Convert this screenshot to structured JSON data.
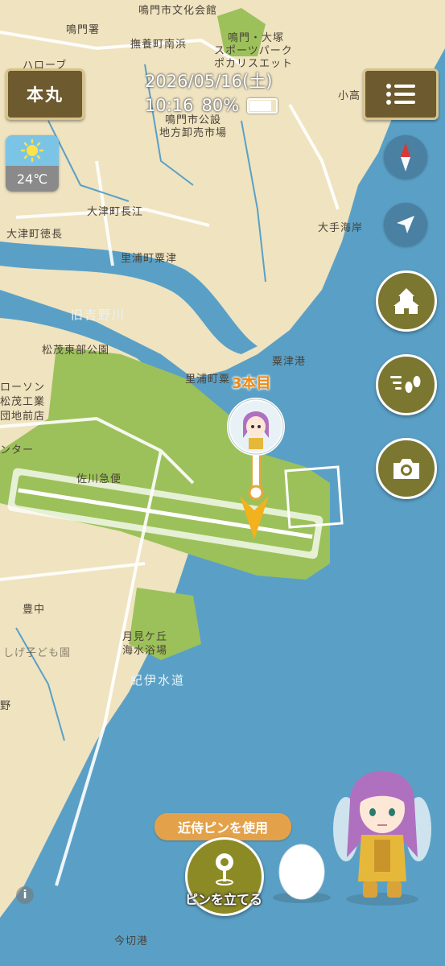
{
  "header": {
    "castle_button": "本丸",
    "date": "2026/05/16(土)",
    "time": "10:16",
    "battery": "80%",
    "battery_level": 0.8
  },
  "weather": {
    "icon": "sun-icon",
    "temperature": "24℃"
  },
  "map_labels": {
    "l1": "鳴門市文化会館",
    "l2": "鳴門署",
    "l3": "撫養町南浜",
    "l4": "鳴門・大塚",
    "l5": "スポーツパーク",
    "l6": "ポカリスエット",
    "l7": "鳴門市公設",
    "l8": "地方卸売市場",
    "l9": "小高",
    "l10": "大津町長江",
    "l11": "大津町徳長",
    "l12": "大手海岸",
    "l13": "里浦町粟津",
    "l14": "旧吉野川",
    "l15": "松茂東部公園",
    "l16": "粟津港",
    "l17": "里浦町粟",
    "l18": "ローソン",
    "l19": "松茂工業",
    "l20": "団地前店",
    "l21": "ンター",
    "l22": "佐川急便",
    "l23": "豊中",
    "l24": "月見ケ丘",
    "l25": "海水浴場",
    "l26": "紀伊水道",
    "l27": "しげ子ども園",
    "l28": "今切港",
    "l29": "野",
    "l30": "ハローブ"
  },
  "pin": {
    "label": "3本目"
  },
  "actions": {
    "use_pin": "近侍ピンを使用",
    "place_pin": "ピンを立てる"
  },
  "side_buttons": [
    "compass-icon",
    "location-arrow-icon",
    "castle-icon",
    "footsteps-icon",
    "camera-icon"
  ],
  "colors": {
    "sea": "#5aa0c6",
    "land": "#efe3c0",
    "green": "#9cc15a",
    "button_olive": "#7b7630",
    "orange": "#f08a10"
  }
}
